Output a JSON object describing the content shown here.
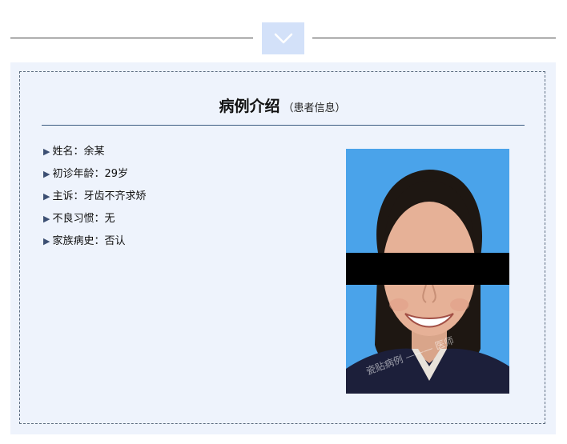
{
  "section": {
    "title": "病例介绍",
    "subtitle": "（患者信息）"
  },
  "patient_info": [
    {
      "label": "姓名：",
      "value": "余某"
    },
    {
      "label": "初诊年龄：",
      "value": "29岁"
    },
    {
      "label": "主诉：",
      "value": "牙齿不齐求矫"
    },
    {
      "label": "不良习惯：",
      "value": "无"
    },
    {
      "label": "家族病史：",
      "value": "否认"
    }
  ],
  "photo": {
    "watermark": "瓷贴病例 ——— 医师"
  },
  "colors": {
    "panel_bg": "#eef3fc",
    "chevron_box": "#d3e1f9",
    "bullet": "#3c4f73",
    "photo_bg": "#4aa3ea"
  },
  "icons": {
    "header_toggle": "chevron-down-icon",
    "bullet": "triangle-right-icon"
  }
}
